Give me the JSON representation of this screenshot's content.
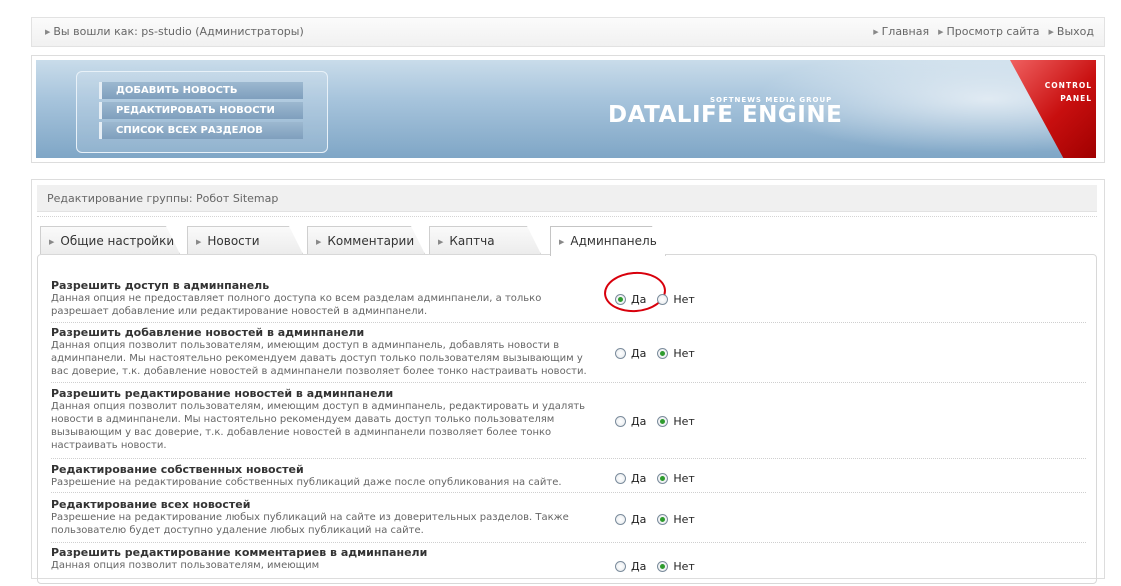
{
  "topbar": {
    "logged_in": "Вы вошли как: ps-studio (Администраторы)",
    "nav": [
      "Главная",
      "Просмотр сайта",
      "Выход"
    ]
  },
  "banner": {
    "menu": [
      "ДОБАВИТЬ НОВОСТЬ",
      "РЕДАКТИРОВАТЬ НОВОСТИ",
      "СПИСОК ВСЕХ РАЗДЕЛОВ"
    ],
    "brand_small": "SOFTNEWS MEDIA GROUP",
    "brand_big": "DATALIFE ENGINE",
    "control_line1": "CONTROL",
    "control_line2": "PANEL"
  },
  "page": {
    "title": "Редактирование группы: Робот Sitemap"
  },
  "tabs": [
    "Общие настройки",
    "Новости",
    "Комментарии",
    "Каптча",
    "Админпанель"
  ],
  "active_tab": "Админпанель",
  "labels": {
    "yes": "Да",
    "no": "Нет"
  },
  "settings": [
    {
      "title": "Разрешить доступ в админпанель",
      "desc": "Данная опция не предоставляет полного доступа ко всем разделам админпанели, а только разрешает добавление или редактирование новостей в админпанели.",
      "value": "yes"
    },
    {
      "title": "Разрешить добавление новостей в админпанели",
      "desc": "Данная опция позволит пользователям, имеющим доступ в админпанель, добавлять новости в админпанели. Мы настоятельно рекомендуем давать доступ только пользователям вызывающим у вас доверие, т.к. добавление новостей в админпанели позволяет более тонко настраивать новости.",
      "value": "no"
    },
    {
      "title": "Разрешить редактирование новостей в админпанели",
      "desc": "Данная опция позволит пользователям, имеющим доступ в админпанель, редактировать и удалять новости в админпанели. Мы настоятельно рекомендуем давать доступ только пользователям вызывающим у вас доверие, т.к. добавление новостей в админпанели позволяет более тонко настраивать новости.",
      "value": "no"
    },
    {
      "title": "Редактирование собственных новостей",
      "desc": "Разрешение на редактирование собственных публикаций даже после опубликования на сайте.",
      "value": "no"
    },
    {
      "title": "Редактирование всех новостей",
      "desc": "Разрешение на редактирование любых публикаций на сайте из доверительных разделов. Также пользователю будет доступно удаление любых публикаций на сайте.",
      "value": "no"
    },
    {
      "title": "Разрешить редактирование комментариев в админпанели",
      "desc": "Данная опция позволит пользователям, имеющим",
      "value": "no"
    }
  ]
}
